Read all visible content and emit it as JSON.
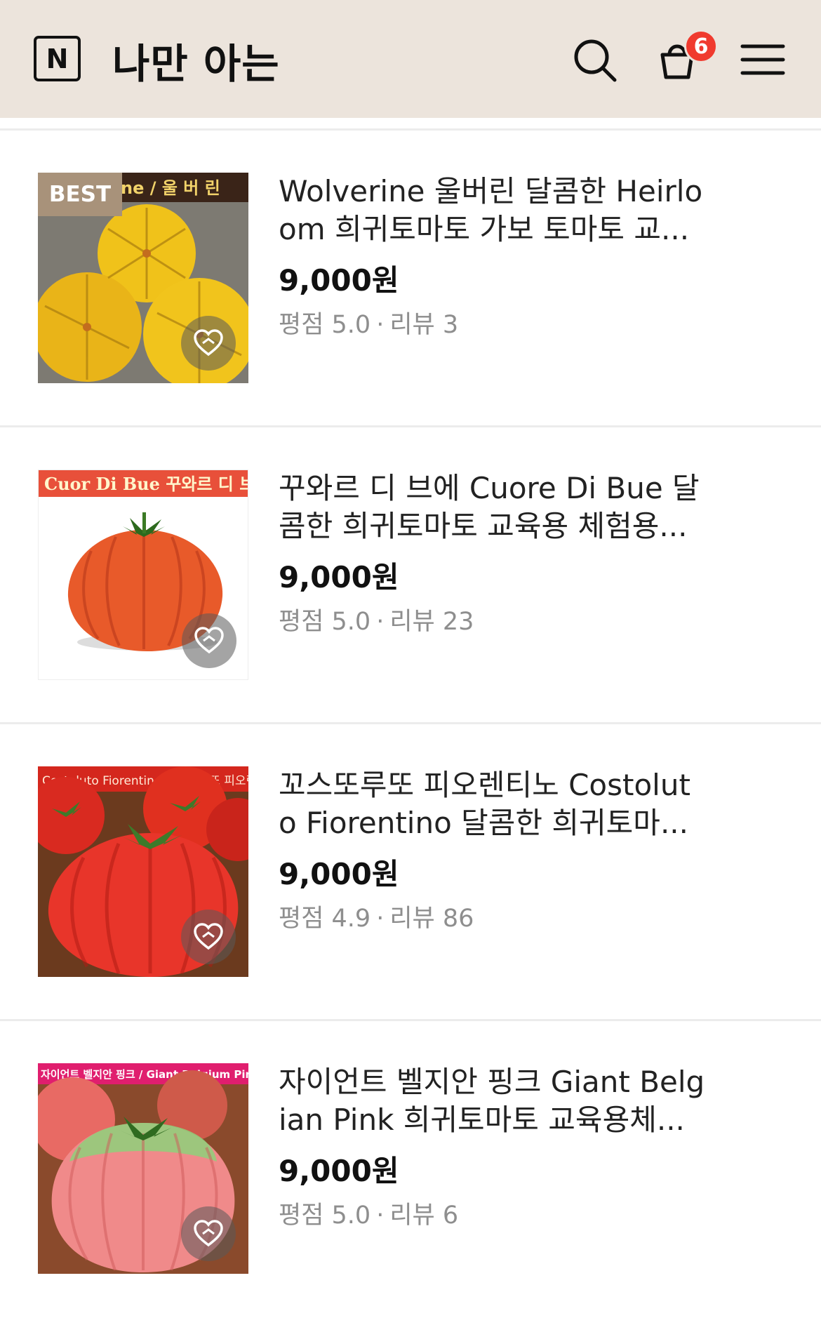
{
  "header": {
    "logo_letter": "N",
    "shop_name": "나만 아는",
    "cart_count": "6",
    "icons": [
      "search-icon",
      "cart-icon",
      "menu-icon"
    ]
  },
  "colors": {
    "header_bg": "#ece4dc",
    "badge": "#f03a2e",
    "best_tag": "#a8927a"
  },
  "products": [
    {
      "title": "Wolverine 울버린 달콤한 Heirlo om 희귀토마토 가보 토마토 교...",
      "price": "9,000원",
      "rating_label": "평점 5.0",
      "dot": "·",
      "review_label": "리뷰 3",
      "badge": "BEST",
      "image_caption": "ne / 울 버 린"
    },
    {
      "title": "꾸와르 디 브에 Cuore Di Bue 달 콤한 희귀토마토 교육용 체험용...",
      "price": "9,000원",
      "rating_label": "평점 5.0",
      "dot": "·",
      "review_label": "리뷰 23",
      "image_caption": "Cuor Di Bue  꾸와르 디 브에"
    },
    {
      "title": "꼬스또루또 피오렌티노 Costolut o Fiorentino 달콤한 희귀토마...",
      "price": "9,000원",
      "rating_label": "평점 4.9",
      "dot": "·",
      "review_label": "리뷰 86",
      "image_caption": "Costoluto Fiorentino  꼬스또루또 피오렌티노"
    },
    {
      "title": "자이언트 벨지안 핑크 Giant Belg ian Pink 희귀토마토 교육용체...",
      "price": "9,000원",
      "rating_label": "평점 5.0",
      "dot": "·",
      "review_label": "리뷰 6",
      "image_caption": "자이언트 벨지안 핑크 / Giant Belgium Pink"
    }
  ]
}
